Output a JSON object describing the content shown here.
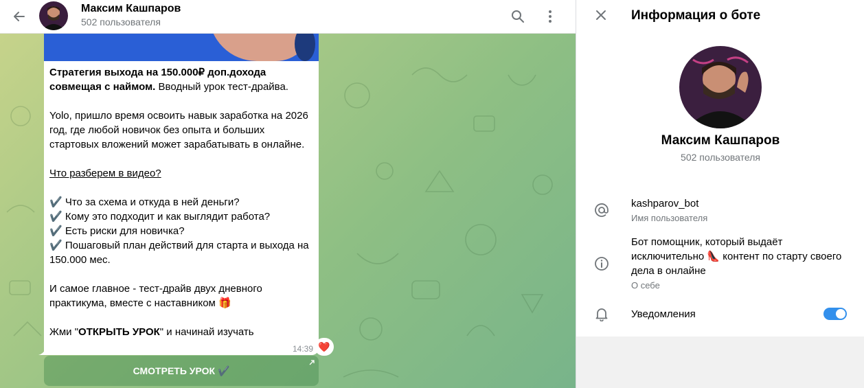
{
  "chat": {
    "header": {
      "title": "Максим Кашпаров",
      "subtitle": "502 пользователя"
    },
    "message": {
      "intro_bold": "Стратегия выхода на 150.000₽ доп.дохода совмещая с наймом.",
      "intro_rest": " Вводный урок тест-драйва.",
      "paragraph": "Yolo, пришло время освоить навык заработка на 2026 год, где любой новичок без опыта и больших стартовых вложений может зарабатывать в онлайне.",
      "section_heading": "Что разберем в видео?",
      "checklist": [
        "Что за схема и откуда в ней деньги?",
        "Кому это подходит и как выглядит работа?",
        "Есть риски для новичка?",
        "Пошаговый план действий для старта и выхода на 150.000 мес."
      ],
      "main_point": "И самое главное - тест-драйв двух дневного практикума, вместе с наставником",
      "main_point_emoji": "🎁",
      "cta_prefix": "Жми \"",
      "cta_bold": "ОТКРЫТЬ УРОК",
      "cta_suffix": "\" и начинай изучать",
      "time": "14:39",
      "reaction": "❤️"
    },
    "inline_button": {
      "label": "СМОТРЕТЬ УРОК ✔️"
    }
  },
  "info_panel": {
    "title": "Информация о боте",
    "name": "Максим Кашпаров",
    "subtitle": "502 пользователя",
    "username": {
      "value": "kashparov_bot",
      "label": "Имя пользователя"
    },
    "about": {
      "text_before": "Бот помощник, который выдаёт исключительно ",
      "emoji": "👠",
      "text_after": " контент по старту своего дела в онлайне",
      "label": "О себе"
    },
    "notifications": {
      "label": "Уведомления",
      "enabled": true
    }
  },
  "colors": {
    "accent": "#3390ec",
    "chat_bg_start": "#c6d38a",
    "chat_bg_end": "#78b48a"
  }
}
